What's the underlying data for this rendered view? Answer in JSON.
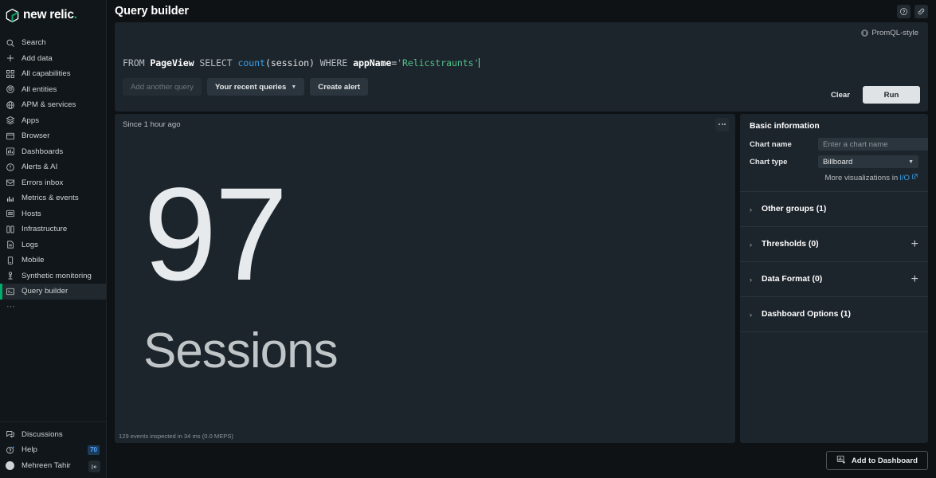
{
  "brand": {
    "name": "new relic",
    "accent": "#00ac69"
  },
  "sidebar": {
    "items": [
      {
        "label": "Search",
        "icon": "search-icon"
      },
      {
        "label": "Add data",
        "icon": "plus-icon"
      },
      {
        "label": "All capabilities",
        "icon": "grid-icon"
      },
      {
        "label": "All entities",
        "icon": "entities-icon"
      },
      {
        "label": "APM & services",
        "icon": "globe-icon"
      },
      {
        "label": "Apps",
        "icon": "layers-icon"
      },
      {
        "label": "Browser",
        "icon": "window-icon"
      },
      {
        "label": "Dashboards",
        "icon": "dashboard-icon"
      },
      {
        "label": "Alerts & AI",
        "icon": "alert-icon"
      },
      {
        "label": "Errors inbox",
        "icon": "inbox-icon"
      },
      {
        "label": "Metrics & events",
        "icon": "bars-icon"
      },
      {
        "label": "Hosts",
        "icon": "hosts-icon"
      },
      {
        "label": "Infrastructure",
        "icon": "infrastructure-icon"
      },
      {
        "label": "Logs",
        "icon": "logs-icon"
      },
      {
        "label": "Mobile",
        "icon": "mobile-icon"
      },
      {
        "label": "Synthetic monitoring",
        "icon": "synthetic-icon"
      },
      {
        "label": "Query builder",
        "icon": "terminal-icon",
        "active": true
      }
    ],
    "more_label": "⋯",
    "bottom": {
      "discussions": "Discussions",
      "help": "Help",
      "help_badge": "70",
      "user": "Mehreen Tahir"
    },
    "collapse_icon": "collapse-panel-icon"
  },
  "header": {
    "title": "Query builder",
    "help_icon": "help-circle-icon",
    "link_icon": "link-icon"
  },
  "query": {
    "promql_label": "PromQL-style",
    "tokens": [
      {
        "t": "FROM",
        "c": "kw"
      },
      {
        "t": " "
      },
      {
        "t": "PageView",
        "c": "ent"
      },
      {
        "t": " "
      },
      {
        "t": "SELECT",
        "c": "kw"
      },
      {
        "t": " "
      },
      {
        "t": "count",
        "c": "fn"
      },
      {
        "t": "(",
        "c": "punct"
      },
      {
        "t": "session",
        "c": "arg"
      },
      {
        "t": ")",
        "c": "punct"
      },
      {
        "t": " "
      },
      {
        "t": "WHERE",
        "c": "kw"
      },
      {
        "t": " "
      },
      {
        "t": "appName",
        "c": "attr"
      },
      {
        "t": "=",
        "c": "op"
      },
      {
        "t": "'Relicstraunts'",
        "c": "str"
      }
    ],
    "text": "FROM PageView SELECT count(session) WHERE appName='Relicstraunts'",
    "add_another_query": "Add another query",
    "recent_queries": "Your recent queries",
    "create_alert": "Create alert",
    "clear": "Clear",
    "run": "Run"
  },
  "chart": {
    "since": "Since 1 hour ago",
    "menu_icon": "more-options-icon",
    "footer": "129 events inspected in 34 ms (0.0 MEPS)"
  },
  "chart_data": {
    "type": "billboard",
    "title": "Sessions",
    "value": "97",
    "value_number": 97,
    "label": "Sessions",
    "time_range": "Since 1 hour ago",
    "query": "FROM PageView SELECT count(session) WHERE appName='Relicstraunts'",
    "events_inspected": 129,
    "duration_ms": 34,
    "meps": "0.0"
  },
  "config": {
    "basic_info_title": "Basic information",
    "chart_name_label": "Chart name",
    "chart_name_value": "",
    "chart_name_placeholder": "Enter a chart name",
    "chart_type_label": "Chart type",
    "chart_type_value": "Billboard",
    "more_viz_prefix": "More visualizations in ",
    "more_viz_link": "I/O",
    "sections": [
      {
        "label": "Other groups (1)",
        "plus": false
      },
      {
        "label": "Thresholds (0)",
        "plus": true
      },
      {
        "label": "Data Format (0)",
        "plus": true
      },
      {
        "label": "Dashboard Options (1)",
        "plus": false
      }
    ]
  },
  "footer": {
    "add_to_dashboard": "Add to Dashboard",
    "add_to_dashboard_icon": "add-dashboard-icon"
  }
}
